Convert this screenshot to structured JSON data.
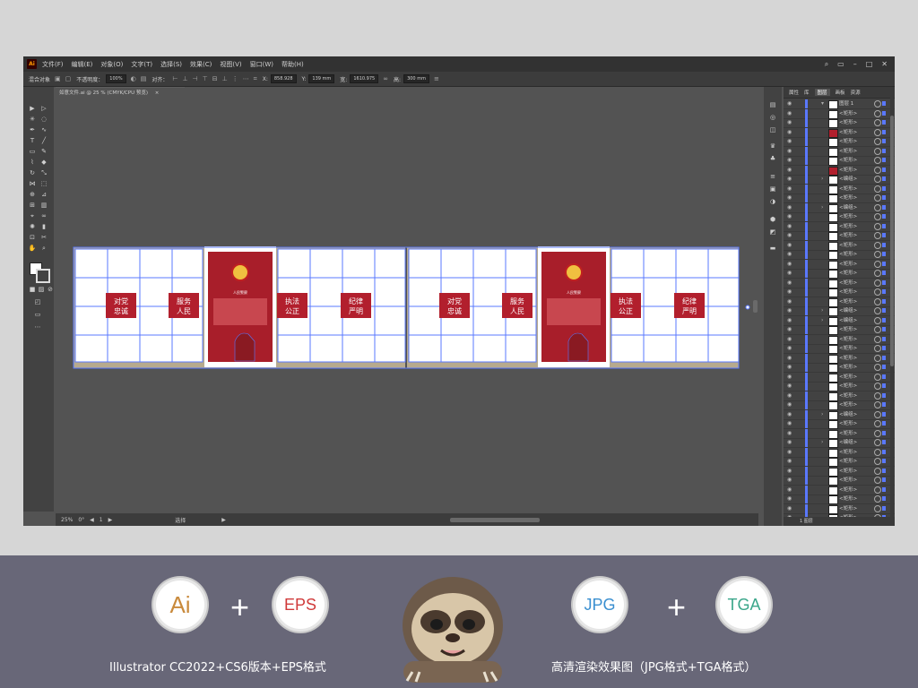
{
  "app": {
    "logo": "Ai",
    "menu": [
      "文件(F)",
      "编辑(E)",
      "对象(O)",
      "文字(T)",
      "选择(S)",
      "效果(C)",
      "视图(V)",
      "窗口(W)",
      "帮助(H)"
    ],
    "control_bar": {
      "selection": "混合对象",
      "opacity_label": "不透明度：",
      "opacity_value": "100%",
      "align_label": "对齐：",
      "x_label": "X:",
      "x_value": "858.928",
      "y_label": "Y:",
      "y_value": "139 mm",
      "w_label": "宽:",
      "w_value": "1610.975",
      "h_label": "高:",
      "h_value": "300 mm"
    },
    "document_tab": "如意文件.ai @ 25 % (CMYK/CPU 预览)",
    "document_tab_close": "×",
    "status": {
      "zoom": "25%",
      "rotation": "0°",
      "artboard": "1",
      "mode": "选择"
    },
    "layers_panel": {
      "tabs": [
        "属性",
        "库",
        "图层",
        "画板",
        "资源"
      ],
      "active_tab": "图层",
      "top_layer": "图层 1",
      "rows": [
        "<矩形>",
        "<矩形>",
        "<矩形>",
        "<矩形>",
        "<矩形>",
        "<矩形>",
        "<矩形>",
        "<编组>",
        "<矩形>",
        "<矩形>",
        "<编组>",
        "<矩形>",
        "<矩形>",
        "<矩形>",
        "<矩形>",
        "<矩形>",
        "<矩形>",
        "<矩形>",
        "<矩形>",
        "<矩形>",
        "<矩形>",
        "<编组>",
        "<编组>",
        "<矩形>",
        "<矩形>",
        "<矩形>",
        "<矩形>",
        "<矩形>",
        "<矩形>",
        "<矩形>",
        "<矩形>",
        "<矩形>",
        "<编组>",
        "<矩形>",
        "<矩形>",
        "<编组>",
        "<矩形>",
        "<矩形>",
        "<矩形>",
        "<矩形>",
        "<矩形>",
        "<矩形>",
        "<矩形>",
        "<矩形>",
        "<矩形>"
      ],
      "footer": "1 图层"
    }
  },
  "design": {
    "panels": [
      "对党\n忠诚",
      "服务\n人民",
      "执法\n公正",
      "纪律\n严明"
    ],
    "poster_title": "人民警察",
    "accent_red": "#b21f2d",
    "poster_red": "#a81e2a",
    "guide_blue": "#5a78ff",
    "frame_tan": "#b7aa8e"
  },
  "promo": {
    "badges": [
      "Ai",
      "EPS",
      "JPG",
      "TGA"
    ],
    "badge_colors": [
      "#c98a3c",
      "#d03a3a",
      "#3a8fd0",
      "#3aa68a"
    ],
    "plus": "+",
    "caption_left": "Illustrator CC2022+CS6版本+EPS格式",
    "caption_right": "高清渲染效果图（JPG格式+TGA格式）"
  }
}
